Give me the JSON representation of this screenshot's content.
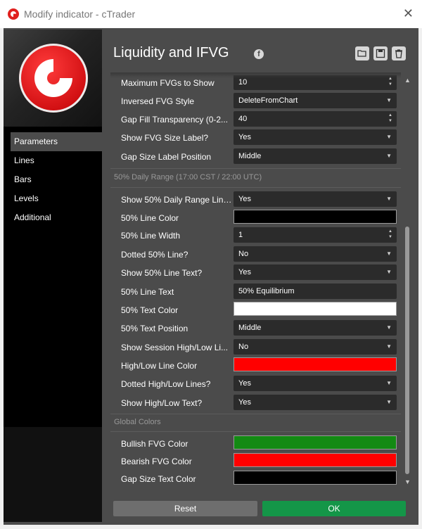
{
  "window": {
    "title": "Modify indicator - cTrader",
    "close_glyph": "✕"
  },
  "header": {
    "title": "Liquidity and IFVG",
    "facebook_glyph": "f"
  },
  "sidebar": {
    "items": [
      {
        "label": "Parameters"
      },
      {
        "label": "Lines"
      },
      {
        "label": "Bars"
      },
      {
        "label": "Levels"
      },
      {
        "label": "Additional"
      }
    ]
  },
  "parameters": {
    "rows": [
      {
        "label": "Maximum FVGs to Show",
        "value": "10"
      },
      {
        "label": "Inversed FVG Style",
        "value": "DeleteFromChart"
      },
      {
        "label": "Gap Fill Transparency (0-2...",
        "value": "40"
      },
      {
        "label": "Show FVG Size Label?",
        "value": "Yes"
      },
      {
        "label": "Gap Size Label Position",
        "value": "Middle"
      }
    ],
    "daily_range": {
      "heading": "50% Daily Range (17:00 CST / 22:00 UTC)",
      "rows": [
        {
          "label": "Show 50% Daily Range Line?",
          "value": "Yes"
        },
        {
          "label": "50% Line Color",
          "color": "#000000"
        },
        {
          "label": "50% Line Width",
          "value": "1"
        },
        {
          "label": "Dotted 50% Line?",
          "value": "No"
        },
        {
          "label": "Show 50% Line Text?",
          "value": "Yes"
        },
        {
          "label": "50% Line Text",
          "value": "50% Equilibrium"
        },
        {
          "label": "50% Text Color",
          "color": "#ffffff"
        },
        {
          "label": "50% Text Position",
          "value": "Middle"
        },
        {
          "label": "Show Session High/Low Li...",
          "value": "No"
        },
        {
          "label": "High/Low Line Color",
          "color": "#ff0000"
        },
        {
          "label": "Dotted High/Low Lines?",
          "value": "Yes"
        },
        {
          "label": "Show High/Low Text?",
          "value": "Yes"
        }
      ]
    },
    "global_colors": {
      "heading": "Global Colors",
      "rows": [
        {
          "label": "Bullish FVG Color",
          "color": "#138a13"
        },
        {
          "label": "Bearish FVG Color",
          "color": "#ff0000"
        },
        {
          "label": "Gap Size Text Color",
          "color": "#000000"
        }
      ]
    }
  },
  "icons": {
    "dropdown": "▼",
    "spin_up": "▲",
    "spin_down": "▼",
    "scroll_up": "▲",
    "scroll_down": "▼"
  },
  "buttons": {
    "reset": "Reset",
    "ok": "OK"
  }
}
